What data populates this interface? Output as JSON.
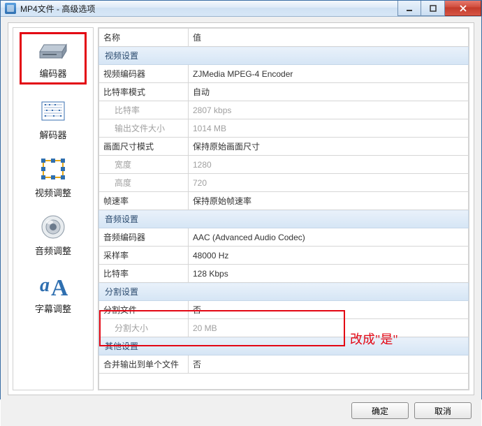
{
  "window": {
    "title": "MP4文件 - 高级选项"
  },
  "sidebar": {
    "items": [
      {
        "id": "encoder",
        "label": "编码器"
      },
      {
        "id": "decoder",
        "label": "解码器"
      },
      {
        "id": "video",
        "label": "视频调整"
      },
      {
        "id": "audio",
        "label": "音频调整"
      },
      {
        "id": "subtitle",
        "label": "字幕调整"
      }
    ]
  },
  "grid": {
    "header": {
      "name": "名称",
      "value": "值"
    },
    "sections": {
      "video": "视频设置",
      "audio": "音频设置",
      "split": "分割设置",
      "other": "其他设置"
    },
    "rows": {
      "video_encoder": {
        "name": "视频编码器",
        "value": "ZJMedia MPEG-4 Encoder"
      },
      "bitrate_mode": {
        "name": "比特率模式",
        "value": "自动"
      },
      "bitrate": {
        "name": "比特率",
        "value": "2807 kbps"
      },
      "out_size": {
        "name": "输出文件大小",
        "value": "1014 MB"
      },
      "frame_mode": {
        "name": "画面尺寸模式",
        "value": "保持原始画面尺寸"
      },
      "width": {
        "name": "宽度",
        "value": "1280"
      },
      "height": {
        "name": "高度",
        "value": "720"
      },
      "fps": {
        "name": "帧速率",
        "value": "保持原始帧速率"
      },
      "audio_encoder": {
        "name": "音频编码器",
        "value": "AAC (Advanced Audio Codec)"
      },
      "sample_rate": {
        "name": "采样率",
        "value": "48000 Hz"
      },
      "audio_bitrate": {
        "name": "比特率",
        "value": "128 Kbps"
      },
      "split_file": {
        "name": "分割文件",
        "value": "否"
      },
      "split_size": {
        "name": "分割大小",
        "value": "20 MB"
      },
      "merge_output": {
        "name": "合并输出到单个文件",
        "value": "否"
      }
    }
  },
  "annotation": "改成\"是\"",
  "footer": {
    "ok": "确定",
    "cancel": "取消"
  }
}
